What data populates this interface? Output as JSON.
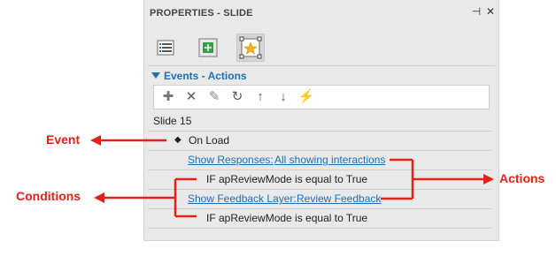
{
  "panel": {
    "title": "PROPERTIES - SLIDE",
    "pin_glyph": "⊣",
    "close_glyph": "✕",
    "tabs": [
      {
        "name": "list-icon"
      },
      {
        "name": "resize-icon"
      },
      {
        "name": "star-icon",
        "active": true
      }
    ]
  },
  "section": {
    "label": "Events - Actions",
    "expanded": true
  },
  "toolbar": {
    "items": [
      {
        "name": "add-icon",
        "glyph": "✚"
      },
      {
        "name": "delete-icon",
        "glyph": "✕"
      },
      {
        "name": "edit-icon",
        "glyph": "✎"
      },
      {
        "name": "refresh-icon",
        "glyph": "↻"
      },
      {
        "name": "move-up-icon",
        "glyph": "↑"
      },
      {
        "name": "move-down-icon",
        "glyph": "↓"
      },
      {
        "name": "effect-icon",
        "glyph": "⚡"
      }
    ]
  },
  "tree": {
    "slide": "Slide 15",
    "event": {
      "bullet": "◆",
      "label": "On Load"
    },
    "action1": {
      "label": "Show Responses:",
      "value": "All showing interactions"
    },
    "condition1": "IF apReviewMode is equal to True",
    "action2": {
      "label": "Show Feedback Layer:",
      "value": "Review Feedback"
    },
    "condition2": "IF apReviewMode is equal to True"
  },
  "annotations": {
    "event": "Event",
    "conditions": "Conditions",
    "actions": "Actions",
    "color": "#e32119"
  }
}
